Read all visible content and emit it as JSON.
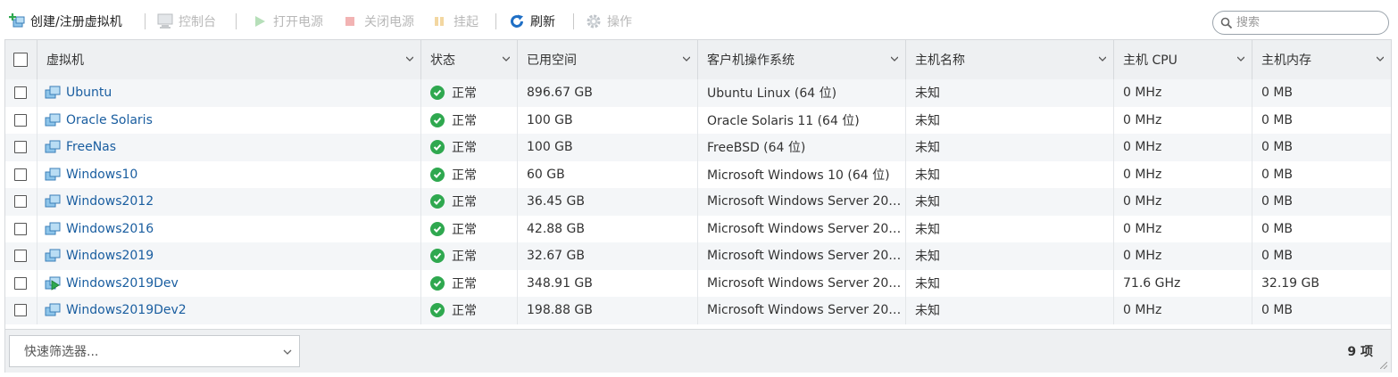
{
  "toolbar": {
    "create_label": "创建/注册虚拟机",
    "console_label": "控制台",
    "power_on_label": "打开电源",
    "power_off_label": "关闭电源",
    "suspend_label": "挂起",
    "refresh_label": "刷新",
    "actions_label": "操作",
    "search_placeholder": "搜索"
  },
  "grid": {
    "columns": [
      "虚拟机",
      "状态",
      "已用空间",
      "客户机操作系统",
      "主机名称",
      "主机 CPU",
      "主机内存"
    ],
    "rows": [
      {
        "name": "Ubuntu",
        "status": "正常",
        "space": "896.67 GB",
        "os": "Ubuntu Linux (64 位)",
        "host": "未知",
        "cpu": "0 MHz",
        "mem": "0 MB",
        "running": false
      },
      {
        "name": "Oracle Solaris",
        "status": "正常",
        "space": "100 GB",
        "os": "Oracle Solaris 11 (64 位)",
        "host": "未知",
        "cpu": "0 MHz",
        "mem": "0 MB",
        "running": false
      },
      {
        "name": "FreeNas",
        "status": "正常",
        "space": "100 GB",
        "os": "FreeBSD (64 位)",
        "host": "未知",
        "cpu": "0 MHz",
        "mem": "0 MB",
        "running": false
      },
      {
        "name": "Windows10",
        "status": "正常",
        "space": "60 GB",
        "os": "Microsoft Windows 10 (64 位)",
        "host": "未知",
        "cpu": "0 MHz",
        "mem": "0 MB",
        "running": false
      },
      {
        "name": "Windows2012",
        "status": "正常",
        "space": "36.45 GB",
        "os": "Microsoft Windows Server 201…",
        "host": "未知",
        "cpu": "0 MHz",
        "mem": "0 MB",
        "running": false
      },
      {
        "name": "Windows2016",
        "status": "正常",
        "space": "42.88 GB",
        "os": "Microsoft Windows Server 201…",
        "host": "未知",
        "cpu": "0 MHz",
        "mem": "0 MB",
        "running": false
      },
      {
        "name": "Windows2019",
        "status": "正常",
        "space": "32.67 GB",
        "os": "Microsoft Windows Server 201…",
        "host": "未知",
        "cpu": "0 MHz",
        "mem": "0 MB",
        "running": false
      },
      {
        "name": "Windows2019Dev",
        "status": "正常",
        "space": "348.91 GB",
        "os": "Microsoft Windows Server 201…",
        "host": "未知",
        "cpu": "71.6 GHz",
        "mem": "32.19 GB",
        "running": true
      },
      {
        "name": "Windows2019Dev2",
        "status": "正常",
        "space": "198.88 GB",
        "os": "Microsoft Windows Server 201…",
        "host": "未知",
        "cpu": "0 MHz",
        "mem": "0 MB",
        "running": false
      }
    ]
  },
  "footer": {
    "filter_label": "快速筛选器...",
    "count_label": "9 项"
  },
  "colors": {
    "link": "#1a5ea0",
    "status_ok": "#2fa84f",
    "header_bg": "#eef0f2",
    "alt_row_bg": "#f4f6f8"
  }
}
